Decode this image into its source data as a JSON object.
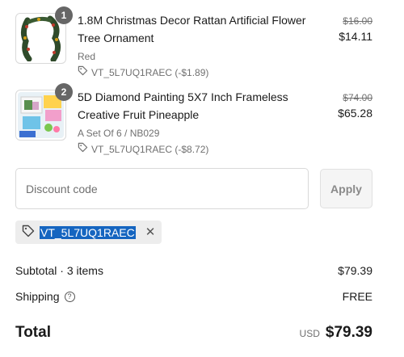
{
  "items": [
    {
      "quantity": "1",
      "title": "1.8M Christmas Decor Rattan Artificial Flower Tree Ornament",
      "variant": "Red",
      "discount": "VT_5L7UQ1RAEC (-$1.89)",
      "original_price": "$16.00",
      "final_price": "$14.11",
      "thumbnail": "christmas-garland-image"
    },
    {
      "quantity": "2",
      "title": "5D Diamond Painting 5X7 Inch Frameless Creative Fruit Pineapple",
      "variant": "A Set Of 6 / NB029",
      "discount": "VT_5L7UQ1RAEC (-$8.72)",
      "original_price": "$74.00",
      "final_price": "$65.28",
      "thumbnail": "diamond-painting-kit-image"
    }
  ],
  "discount_form": {
    "placeholder": "Discount code",
    "apply_label": "Apply"
  },
  "applied_code": {
    "code": "VT_5L7UQ1RAEC",
    "icon": "tag-icon",
    "remove_icon": "close-icon"
  },
  "summary": {
    "subtotal_label": "Subtotal · 3 items",
    "subtotal_value": "$79.39",
    "shipping_label": "Shipping",
    "shipping_value": "FREE",
    "total_label": "Total",
    "currency": "USD",
    "total_value": "$79.39"
  },
  "colors": {
    "badge": "#666666",
    "selection": "#1565c0",
    "muted_text": "#707070",
    "border": "#d9d9d9"
  }
}
